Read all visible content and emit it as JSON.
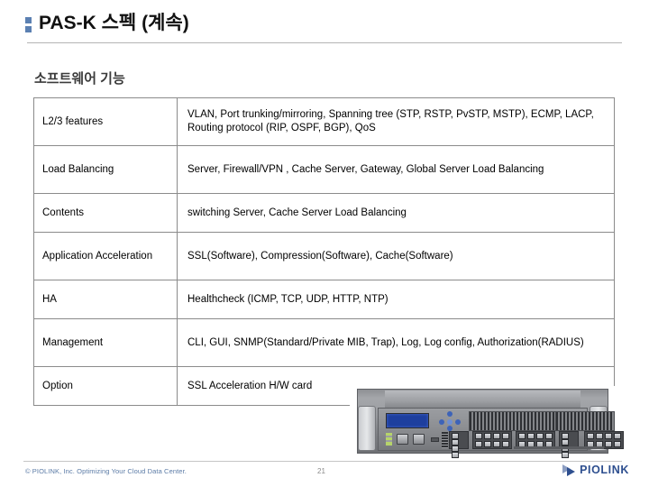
{
  "slide": {
    "title": "PAS-K 스펙 (계속)",
    "bullet_icon": "square-bullet-icon",
    "subtitle": "소프트웨어 기능"
  },
  "table": {
    "rows": [
      {
        "label": "L2/3 features",
        "value": "VLAN, Port trunking/mirroring, Spanning tree (STP, RSTP, PvSTP, MSTP), ECMP, LACP, Routing protocol (RIP, OSPF, BGP), QoS"
      },
      {
        "label": "Load Balancing",
        "value": "Server, Firewall/VPN , Cache Server, Gateway, Global Server Load Balancing"
      },
      {
        "label": "Contents",
        "value": "switching Server, Cache Server Load Balancing"
      },
      {
        "label": "Application Acceleration",
        "value": "SSL(Software), Compression(Software), Cache(Software)"
      },
      {
        "label": "HA",
        "value": "Healthcheck (ICMP, TCP, UDP, HTTP, NTP)"
      },
      {
        "label": "Management",
        "value": "CLI, GUI, SNMP(Standard/Private MIB, Trap), Log, Log config, Authorization(RADIUS)"
      },
      {
        "label": "Option",
        "value": "SSL Acceleration H/W card"
      }
    ]
  },
  "device": {
    "alt": "PAS-K rack mount appliance front panel photo",
    "icon": "network-appliance-photo"
  },
  "footer": {
    "copyright": "© PIOLINK, Inc. Optimizing Your Cloud Data Center.",
    "page_number": "21",
    "logo_text": "PIOLINK",
    "logo_icon": "piolink-arrow-logo-icon"
  },
  "colors": {
    "bullet_blue": "#5b80b2",
    "logo_blue": "#2e4f8f",
    "table_border": "#8b8b8b",
    "rule_gray": "#b4b4b4",
    "footer_text_blue": "#5b7ba6"
  }
}
